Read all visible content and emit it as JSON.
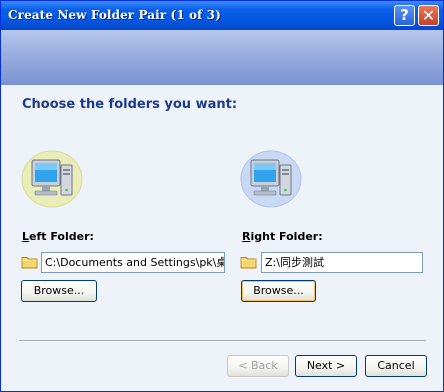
{
  "window": {
    "title": "Create New Folder Pair (1 of 3)"
  },
  "titlebar_buttons": {
    "help": "?",
    "close": "✕"
  },
  "page": {
    "heading": "Choose the folders you want:"
  },
  "left": {
    "label_accel": "L",
    "label_rest": "eft Folder:",
    "path": "C:\\Documents and Settings\\pk\\桌面\\",
    "browse_label": "Browse..."
  },
  "right": {
    "label_accel": "R",
    "label_rest": "ight Folder:",
    "path": "Z:\\同步測試",
    "browse_label": "Browse..."
  },
  "footer": {
    "back_label": "< Back",
    "next_label": "Next >",
    "cancel_label": "Cancel",
    "back_enabled": false
  },
  "colors": {
    "titlebar": "#0356e0",
    "accent": "#1d3b8a",
    "banner": "#93a9de"
  },
  "icons": {
    "computer": "computer-icon",
    "folder": "folder-icon"
  }
}
